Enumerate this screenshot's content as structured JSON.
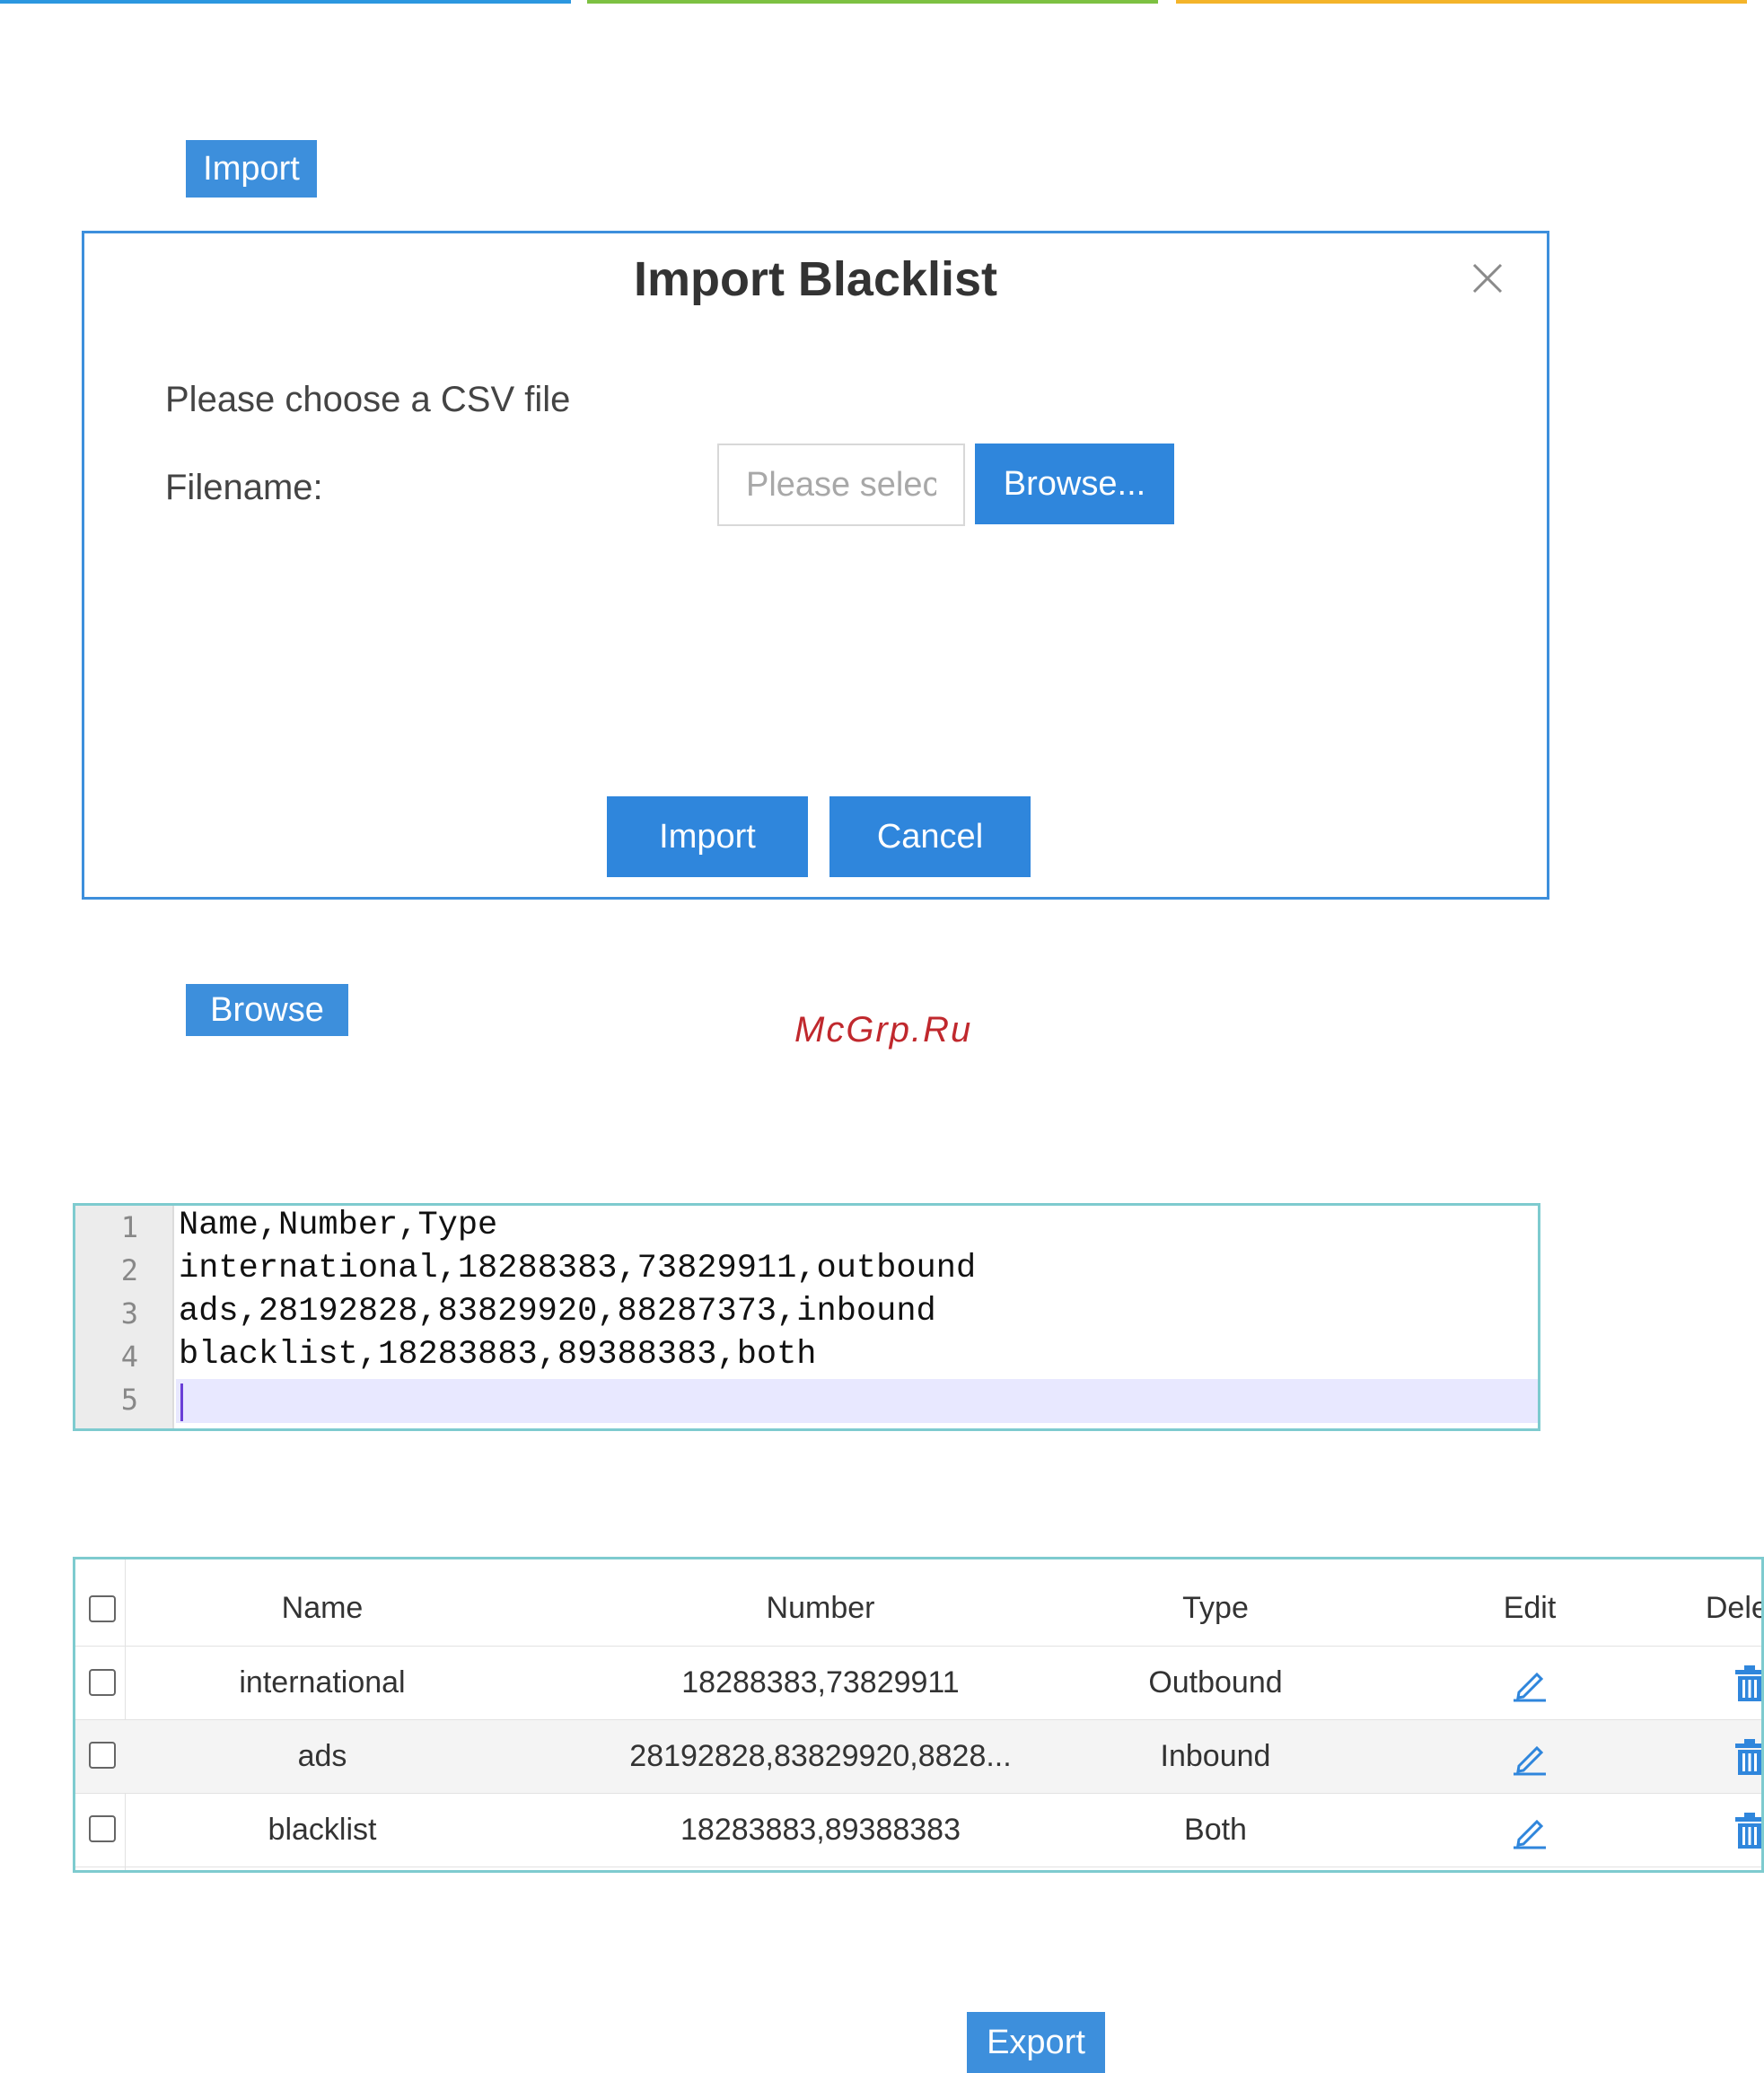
{
  "colors": {
    "stripe_blue": "#2b97e0",
    "stripe_green": "#7dc142",
    "stripe_orange": "#f4b42a",
    "button_blue": "#2f86dc",
    "dialog_border": "#3d8fdc",
    "panel_border": "#7ecbcf",
    "watermark": "#c0282d"
  },
  "import_button": {
    "label": "Import"
  },
  "dialog": {
    "title": "Import Blacklist",
    "close_icon": "close-icon",
    "prompt": "Please choose a CSV file",
    "filename_label": "Filename:",
    "filename_placeholder": "Please select",
    "browse_label": "Browse...",
    "import_label": "Import",
    "cancel_label": "Cancel"
  },
  "browse_button": {
    "label": "Browse"
  },
  "watermark": "McGrp.Ru",
  "editor": {
    "lines": [
      {
        "num": "1",
        "text": "Name,Number,Type"
      },
      {
        "num": "2",
        "text": "international,18288383,73829911,outbound"
      },
      {
        "num": "3",
        "text": "ads,28192828,83829920,88287373,inbound"
      },
      {
        "num": "4",
        "text": "blacklist,18283883,89388383,both"
      },
      {
        "num": "5",
        "text": ""
      }
    ]
  },
  "table": {
    "headers": [
      "Name",
      "Number",
      "Type",
      "Edit",
      "Delete"
    ],
    "rows": [
      {
        "name": "international",
        "number": "18288383,73829911",
        "type": "Outbound"
      },
      {
        "name": "ads",
        "number": "28192828,83829920,8828...",
        "type": "Inbound"
      },
      {
        "name": "blacklist",
        "number": "18283883,89388383",
        "type": "Both"
      }
    ],
    "edit_icon": "pencil-icon",
    "delete_icon": "trash-icon"
  },
  "export_button": {
    "label": "Export"
  }
}
